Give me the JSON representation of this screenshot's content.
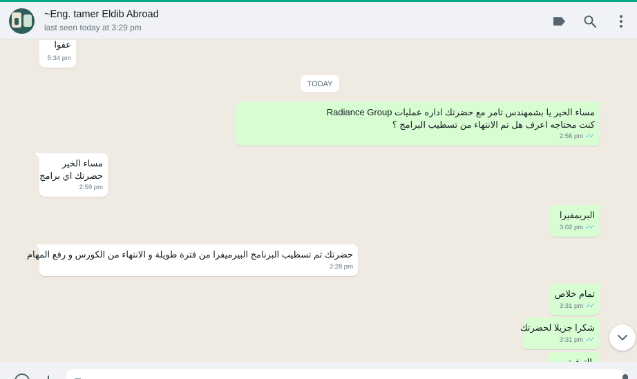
{
  "header": {
    "contact_name": "~Eng. tamer Eldib Abroad",
    "status": "last seen today at 3:29 pm",
    "icons": [
      "label-icon",
      "search-icon",
      "menu-icon"
    ]
  },
  "date_divider": "TODAY",
  "messages": [
    {
      "direction": "in",
      "lines": [
        "عفوا"
      ],
      "time": "5:34 pm"
    },
    {
      "direction": "out",
      "lines": [
        "مساء الخير يا بشمهندس تامر مع حضرتك اداره عمليات Radiance Group",
        "كنت محتاجه اعرف هل تم الانتهاء من تسطيب البرامج ؟"
      ],
      "time": "2:56 pm"
    },
    {
      "direction": "in",
      "lines": [
        "مساء الخير",
        "حضرتك اي برامج"
      ],
      "time": "2:59 pm"
    },
    {
      "direction": "out",
      "lines": [
        "البريمفيرا"
      ],
      "time": "3:02 pm"
    },
    {
      "direction": "in",
      "lines": [
        "حضرتك تم تسطيب البرنامج البيرميفرا من فترة طويلة و الانتهاء من الكورس و رفع المهام"
      ],
      "time": "3:28 pm"
    },
    {
      "direction": "out",
      "lines": [
        "تمام خلاص"
      ],
      "time": "3:31 pm"
    },
    {
      "direction": "out",
      "lines": [
        "شكرا جزيلا لحضرتك"
      ],
      "time": "3:31 pm"
    },
    {
      "direction": "out",
      "lines": [
        "بالتوفيق"
      ],
      "time": ""
    }
  ],
  "colors": {
    "accent": "#00a884",
    "outgoing_bubble": "#d9fdd3",
    "incoming_bubble": "#ffffff",
    "chat_background": "#efeae2",
    "read_tick": "#53bdeb"
  },
  "composer": {
    "placeholder": "T"
  }
}
